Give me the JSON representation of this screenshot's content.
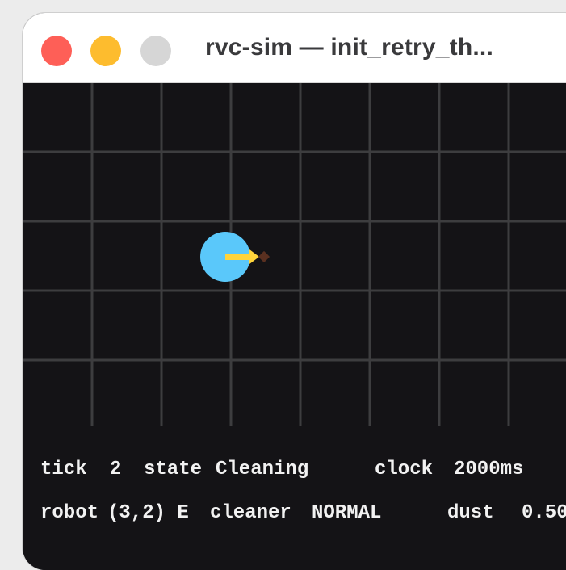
{
  "window": {
    "title": "rvc-sim — init_retry_th..."
  },
  "colors": {
    "window_bg": "#141316",
    "grid_line": "#3d3d3f",
    "robot_body": "#5ac8fa",
    "heading_indicator": "#ffd43b",
    "dust_mark": "#5a3020",
    "close_light": "#fe5f57",
    "minimize_light": "#fdbc2e",
    "zoom_light": "#d6d6d6"
  },
  "grid": {
    "robot_cell": [
      3,
      2
    ],
    "robot_heading": "E",
    "dust_cell": [
      3,
      2
    ]
  },
  "status": {
    "tick_label": "tick",
    "tick_value": "2",
    "state_label": "state",
    "state_value": "Cleaning",
    "clock_label": "clock",
    "clock_value": "2000ms",
    "robot_label": "robot",
    "robot_value": "(3,2) E",
    "cleaner_label": "cleaner",
    "cleaner_value": "NORMAL",
    "dust_label": "dust",
    "dust_value": "0.50"
  }
}
